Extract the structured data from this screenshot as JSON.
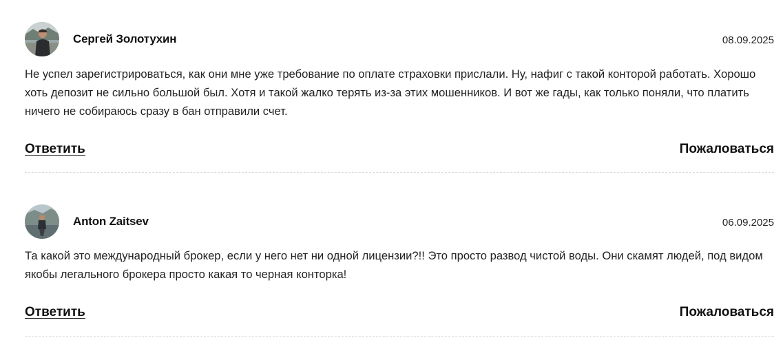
{
  "comments": [
    {
      "author": "Сергей Золотухин",
      "date": "08.09.2025",
      "text": "Не успел зарегистрироваться, как они мне уже требование по оплате страховки прислали. Ну, нафиг с такой конторой работать. Хорошо хоть депозит не сильно большой был. Хотя и такой жалко терять из-за этих мошенников. И вот же гады, как только поняли, что платить ничего не собираюсь сразу в бан отправили счет.",
      "reply_label": "Ответить",
      "report_label": "Пожаловаться"
    },
    {
      "author": "Anton Zaitsev",
      "date": "06.09.2025",
      "text": "Та какой это международный брокер, если у него нет ни одной лицензии?!! Это просто развод чистой воды. Они скамят людей, под видом якобы легального брокера просто какая то черная конторка!",
      "reply_label": "Ответить",
      "report_label": "Пожаловаться"
    }
  ]
}
